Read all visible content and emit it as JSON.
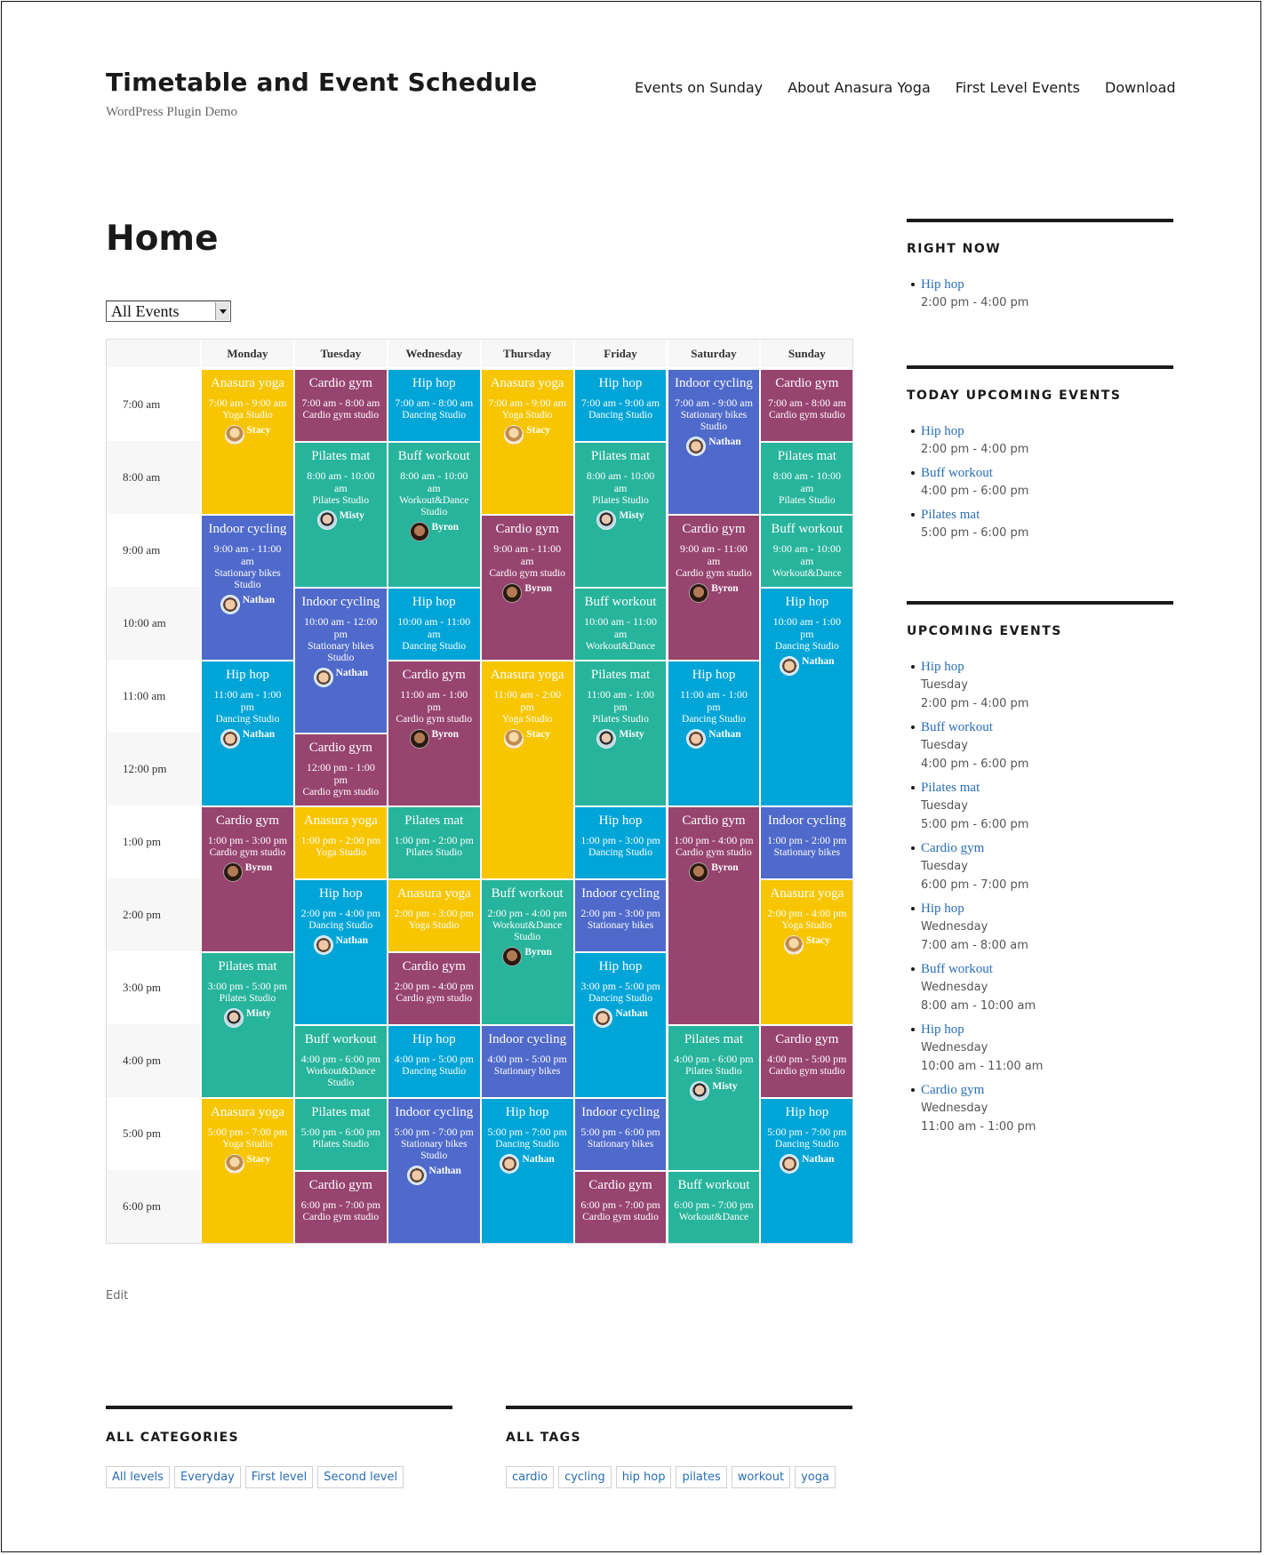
{
  "site": {
    "title": "Timetable and Event Schedule",
    "description": "WordPress Plugin Demo"
  },
  "nav": [
    "Events on Sunday",
    "About Anasura Yoga",
    "First Level Events",
    "Download"
  ],
  "page": {
    "title": "Home",
    "filter_selected": "All Events",
    "edit_label": "Edit"
  },
  "colors": {
    "Anasura yoga": "#f7c600",
    "Cardio gym": "#97446f",
    "Hip hop": "#00a5d8",
    "Pilates mat": "#27b49c",
    "Buff workout": "#27b49c",
    "Indoor cycling": "#4f6acb",
    "link": "#2a6db5"
  },
  "timetable": {
    "days": [
      "Monday",
      "Tuesday",
      "Wednesday",
      "Thursday",
      "Friday",
      "Saturday",
      "Sunday"
    ],
    "hours": [
      "7:00 am",
      "8:00 am",
      "9:00 am",
      "10:00 am",
      "11:00 am",
      "12:00 pm",
      "1:00 pm",
      "2:00 pm",
      "3:00 pm",
      "4:00 pm",
      "5:00 pm",
      "6:00 pm"
    ],
    "events": [
      {
        "day": 0,
        "start": 7,
        "end": 9,
        "title": "Anasura yoga",
        "time": "7:00 am - 9:00 am",
        "location": "Yoga Studio",
        "person": "Stacy"
      },
      {
        "day": 0,
        "start": 9,
        "end": 11,
        "title": "Indoor cycling",
        "time": "9:00 am - 11:00 am",
        "location": "Stationary bikes Studio",
        "person": "Nathan"
      },
      {
        "day": 0,
        "start": 11,
        "end": 13,
        "title": "Hip hop",
        "time": "11:00 am - 1:00 pm",
        "location": "Dancing Studio",
        "person": "Nathan"
      },
      {
        "day": 0,
        "start": 13,
        "end": 15,
        "title": "Cardio gym",
        "time": "1:00 pm - 3:00 pm",
        "location": "Cardio gym studio",
        "person": "Byron"
      },
      {
        "day": 0,
        "start": 15,
        "end": 17,
        "title": "Pilates mat",
        "time": "3:00 pm - 5:00 pm",
        "location": "Pilates Studio",
        "person": "Misty"
      },
      {
        "day": 0,
        "start": 17,
        "end": 19,
        "title": "Anasura yoga",
        "time": "5:00 pm - 7:00 pm",
        "location": "Yoga Studio",
        "person": "Stacy"
      },
      {
        "day": 1,
        "start": 7,
        "end": 8,
        "title": "Cardio gym",
        "time": "7:00 am - 8:00 am",
        "location": "Cardio gym studio",
        "person": ""
      },
      {
        "day": 1,
        "start": 8,
        "end": 10,
        "title": "Pilates mat",
        "time": "8:00 am - 10:00 am",
        "location": "Pilates Studio",
        "person": "Misty"
      },
      {
        "day": 1,
        "start": 10,
        "end": 12,
        "title": "Indoor cycling",
        "time": "10:00 am - 12:00 pm",
        "location": "Stationary bikes Studio",
        "person": "Nathan"
      },
      {
        "day": 1,
        "start": 12,
        "end": 13,
        "title": "Cardio gym",
        "time": "12:00 pm - 1:00 pm",
        "location": "Cardio gym studio",
        "person": ""
      },
      {
        "day": 1,
        "start": 13,
        "end": 14,
        "title": "Anasura yoga",
        "time": "1:00 pm - 2:00 pm",
        "location": "Yoga Studio",
        "person": ""
      },
      {
        "day": 1,
        "start": 14,
        "end": 16,
        "title": "Hip hop",
        "time": "2:00 pm - 4:00 pm",
        "location": "Dancing Studio",
        "person": "Nathan"
      },
      {
        "day": 1,
        "start": 16,
        "end": 17,
        "title": "Buff workout",
        "time": "4:00 pm - 6:00 pm",
        "location": "Workout&Dance Studio",
        "person": ""
      },
      {
        "day": 1,
        "start": 17,
        "end": 18,
        "title": "Pilates mat",
        "time": "5:00 pm - 6:00 pm",
        "location": "Pilates Studio",
        "person": ""
      },
      {
        "day": 1,
        "start": 18,
        "end": 19,
        "title": "Cardio gym",
        "time": "6:00 pm - 7:00 pm",
        "location": "Cardio gym studio",
        "person": ""
      },
      {
        "day": 2,
        "start": 7,
        "end": 8,
        "title": "Hip hop",
        "time": "7:00 am - 8:00 am",
        "location": "Dancing Studio",
        "person": ""
      },
      {
        "day": 2,
        "start": 8,
        "end": 10,
        "title": "Buff workout",
        "time": "8:00 am - 10:00 am",
        "location": "Workout&Dance Studio",
        "person": "Byron"
      },
      {
        "day": 2,
        "start": 10,
        "end": 11,
        "title": "Hip hop",
        "time": "10:00 am - 11:00 am",
        "location": "Dancing Studio",
        "person": ""
      },
      {
        "day": 2,
        "start": 11,
        "end": 13,
        "title": "Cardio gym",
        "time": "11:00 am - 1:00 pm",
        "location": "Cardio gym studio",
        "person": "Byron"
      },
      {
        "day": 2,
        "start": 13,
        "end": 14,
        "title": "Pilates mat",
        "time": "1:00 pm - 2:00 pm",
        "location": "Pilates Studio",
        "person": ""
      },
      {
        "day": 2,
        "start": 14,
        "end": 15,
        "title": "Anasura yoga",
        "time": "2:00 pm - 3:00 pm",
        "location": "Yoga Studio",
        "person": ""
      },
      {
        "day": 2,
        "start": 15,
        "end": 16,
        "title": "Cardio gym",
        "time": "2:00 pm - 4:00 pm",
        "location": "Cardio gym studio",
        "person": ""
      },
      {
        "day": 2,
        "start": 16,
        "end": 17,
        "title": "Hip hop",
        "time": "4:00 pm - 5:00 pm",
        "location": "Dancing Studio",
        "person": ""
      },
      {
        "day": 2,
        "start": 17,
        "end": 19,
        "title": "Indoor cycling",
        "time": "5:00 pm - 7:00 pm",
        "location": "Stationary bikes Studio",
        "person": "Nathan"
      },
      {
        "day": 3,
        "start": 7,
        "end": 9,
        "title": "Anasura yoga",
        "time": "7:00 am - 9:00 am",
        "location": "Yoga Studio",
        "person": "Stacy"
      },
      {
        "day": 3,
        "start": 9,
        "end": 11,
        "title": "Cardio gym",
        "time": "9:00 am - 11:00 am",
        "location": "Cardio gym studio",
        "person": "Byron"
      },
      {
        "day": 3,
        "start": 11,
        "end": 14,
        "title": "Anasura yoga",
        "time": "11:00 am - 2:00 pm",
        "location": "Yoga Studio",
        "person": "Stacy"
      },
      {
        "day": 3,
        "start": 14,
        "end": 16,
        "title": "Buff workout",
        "time": "2:00 pm - 4:00 pm",
        "location": "Workout&Dance Studio",
        "person": "Byron"
      },
      {
        "day": 3,
        "start": 16,
        "end": 17,
        "title": "Indoor cycling",
        "time": "4:00 pm - 5:00 pm",
        "location": "Stationary bikes",
        "person": ""
      },
      {
        "day": 3,
        "start": 17,
        "end": 19,
        "title": "Hip hop",
        "time": "5:00 pm - 7:00 pm",
        "location": "Dancing Studio",
        "person": "Nathan"
      },
      {
        "day": 4,
        "start": 7,
        "end": 8,
        "title": "Hip hop",
        "time": "7:00 am - 9:00 am",
        "location": "Dancing Studio",
        "person": ""
      },
      {
        "day": 4,
        "start": 8,
        "end": 10,
        "title": "Pilates mat",
        "time": "8:00 am - 10:00 am",
        "location": "Pilates Studio",
        "person": "Misty"
      },
      {
        "day": 4,
        "start": 10,
        "end": 11,
        "title": "Buff workout",
        "time": "10:00 am - 11:00 am",
        "location": "Workout&Dance",
        "person": ""
      },
      {
        "day": 4,
        "start": 11,
        "end": 13,
        "title": "Pilates mat",
        "time": "11:00 am - 1:00 pm",
        "location": "Pilates Studio",
        "person": "Misty"
      },
      {
        "day": 4,
        "start": 13,
        "end": 14,
        "title": "Hip hop",
        "time": "1:00 pm - 3:00 pm",
        "location": "Dancing Studio",
        "person": ""
      },
      {
        "day": 4,
        "start": 14,
        "end": 15,
        "title": "Indoor cycling",
        "time": "2:00 pm - 3:00 pm",
        "location": "Stationary bikes",
        "person": ""
      },
      {
        "day": 4,
        "start": 15,
        "end": 17,
        "title": "Hip hop",
        "time": "3:00 pm - 5:00 pm",
        "location": "Dancing Studio",
        "person": "Nathan"
      },
      {
        "day": 4,
        "start": 17,
        "end": 18,
        "title": "Indoor cycling",
        "time": "5:00 pm - 6:00 pm",
        "location": "Stationary bikes",
        "person": ""
      },
      {
        "day": 4,
        "start": 18,
        "end": 19,
        "title": "Cardio gym",
        "time": "6:00 pm - 7:00 pm",
        "location": "Cardio gym studio",
        "person": ""
      },
      {
        "day": 5,
        "start": 7,
        "end": 9,
        "title": "Indoor cycling",
        "time": "7:00 am - 9:00 am",
        "location": "Stationary bikes Studio",
        "person": "Nathan"
      },
      {
        "day": 5,
        "start": 9,
        "end": 11,
        "title": "Cardio gym",
        "time": "9:00 am - 11:00 am",
        "location": "Cardio gym studio",
        "person": "Byron"
      },
      {
        "day": 5,
        "start": 11,
        "end": 13,
        "title": "Hip hop",
        "time": "11:00 am - 1:00 pm",
        "location": "Dancing Studio",
        "person": "Nathan"
      },
      {
        "day": 5,
        "start": 13,
        "end": 16,
        "title": "Cardio gym",
        "time": "1:00 pm - 4:00 pm",
        "location": "Cardio gym studio",
        "person": "Byron"
      },
      {
        "day": 5,
        "start": 16,
        "end": 18,
        "title": "Pilates mat",
        "time": "4:00 pm - 6:00 pm",
        "location": "Pilates Studio",
        "person": "Misty"
      },
      {
        "day": 5,
        "start": 18,
        "end": 19,
        "title": "Buff workout",
        "time": "6:00 pm - 7:00 pm",
        "location": "Workout&Dance",
        "person": ""
      },
      {
        "day": 6,
        "start": 7,
        "end": 8,
        "title": "Cardio gym",
        "time": "7:00 am - 8:00 am",
        "location": "Cardio gym studio",
        "person": ""
      },
      {
        "day": 6,
        "start": 8,
        "end": 9,
        "title": "Pilates mat",
        "time": "8:00 am - 10:00 am",
        "location": "Pilates Studio",
        "person": ""
      },
      {
        "day": 6,
        "start": 9,
        "end": 10,
        "title": "Buff workout",
        "time": "9:00 am - 10:00 am",
        "location": "Workout&Dance",
        "person": ""
      },
      {
        "day": 6,
        "start": 10,
        "end": 13,
        "title": "Hip hop",
        "time": "10:00 am - 1:00 pm",
        "location": "Dancing Studio",
        "person": "Nathan"
      },
      {
        "day": 6,
        "start": 13,
        "end": 14,
        "title": "Indoor cycling",
        "time": "1:00 pm - 2:00 pm",
        "location": "Stationary bikes",
        "person": ""
      },
      {
        "day": 6,
        "start": 14,
        "end": 16,
        "title": "Anasura yoga",
        "time": "2:00 pm - 4:00 pm",
        "location": "Yoga Studio",
        "person": "Stacy"
      },
      {
        "day": 6,
        "start": 16,
        "end": 17,
        "title": "Cardio gym",
        "time": "4:00 pm - 5:00 pm",
        "location": "Cardio gym studio",
        "person": ""
      },
      {
        "day": 6,
        "start": 17,
        "end": 19,
        "title": "Hip hop",
        "time": "5:00 pm - 7:00 pm",
        "location": "Dancing Studio",
        "person": "Nathan"
      }
    ]
  },
  "sidebar": {
    "right_now": {
      "title": "RIGHT NOW",
      "items": [
        {
          "name": "Hip hop",
          "time": "2:00 pm - 4:00 pm"
        }
      ]
    },
    "today_upcoming": {
      "title": "TODAY UPCOMING EVENTS",
      "items": [
        {
          "name": "Hip hop",
          "time": "2:00 pm - 4:00 pm"
        },
        {
          "name": "Buff workout",
          "time": "4:00 pm - 6:00 pm"
        },
        {
          "name": "Pilates mat",
          "time": "5:00 pm - 6:00 pm"
        }
      ]
    },
    "upcoming": {
      "title": "UPCOMING EVENTS",
      "items": [
        {
          "name": "Hip hop",
          "day": "Tuesday",
          "time": "2:00 pm - 4:00 pm"
        },
        {
          "name": "Buff workout",
          "day": "Tuesday",
          "time": "4:00 pm - 6:00 pm"
        },
        {
          "name": "Pilates mat",
          "day": "Tuesday",
          "time": "5:00 pm - 6:00 pm"
        },
        {
          "name": "Cardio gym",
          "day": "Tuesday",
          "time": "6:00 pm - 7:00 pm"
        },
        {
          "name": "Hip hop",
          "day": "Wednesday",
          "time": "7:00 am - 8:00 am"
        },
        {
          "name": "Buff workout",
          "day": "Wednesday",
          "time": "8:00 am - 10:00 am"
        },
        {
          "name": "Hip hop",
          "day": "Wednesday",
          "time": "10:00 am - 11:00 am"
        },
        {
          "name": "Cardio gym",
          "day": "Wednesday",
          "time": "11:00 am - 1:00 pm"
        }
      ]
    }
  },
  "footer": {
    "categories": {
      "title": "ALL CATEGORIES",
      "items": [
        "All levels",
        "Everyday",
        "First level",
        "Second level"
      ]
    },
    "tags": {
      "title": "ALL TAGS",
      "items": [
        "cardio",
        "cycling",
        "hip hop",
        "pilates",
        "workout",
        "yoga"
      ]
    }
  }
}
